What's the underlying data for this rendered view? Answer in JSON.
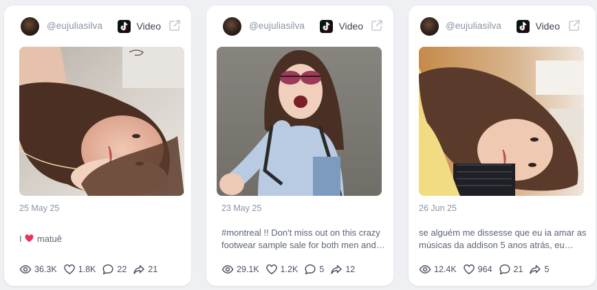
{
  "posts": [
    {
      "username": "@eujuliasilva",
      "platform_icon": "tiktok-icon",
      "type_label": "Video",
      "date": "25 May 25",
      "caption_before": "I",
      "caption_emoji": "heart",
      "caption_after": "matuê",
      "stats": {
        "views": "36.3K",
        "likes": "1.8K",
        "comments": "22",
        "shares": "21"
      }
    },
    {
      "username": "@eujuliasilva",
      "platform_icon": "tiktok-icon",
      "type_label": "Video",
      "date": "23 May 25",
      "caption": "#montreal !! Don't miss out on this crazy footwear sample sale for both men and…",
      "stats": {
        "views": "29.1K",
        "likes": "1.2K",
        "comments": "5",
        "shares": "12"
      }
    },
    {
      "username": "@eujuliasilva",
      "platform_icon": "tiktok-icon",
      "type_label": "Video",
      "date": "26 Jun 25",
      "caption": "se alguém me dissesse que eu ia amar as músicas da addison 5 anos atrás, eu…",
      "stats": {
        "views": "12.4K",
        "likes": "964",
        "comments": "21",
        "shares": "5"
      }
    }
  ],
  "colors": {
    "background": "#eef0f3",
    "card": "#ffffff",
    "muted_text": "#8a93a4",
    "body_text": "#5b6475",
    "heart": "#e8335a"
  }
}
